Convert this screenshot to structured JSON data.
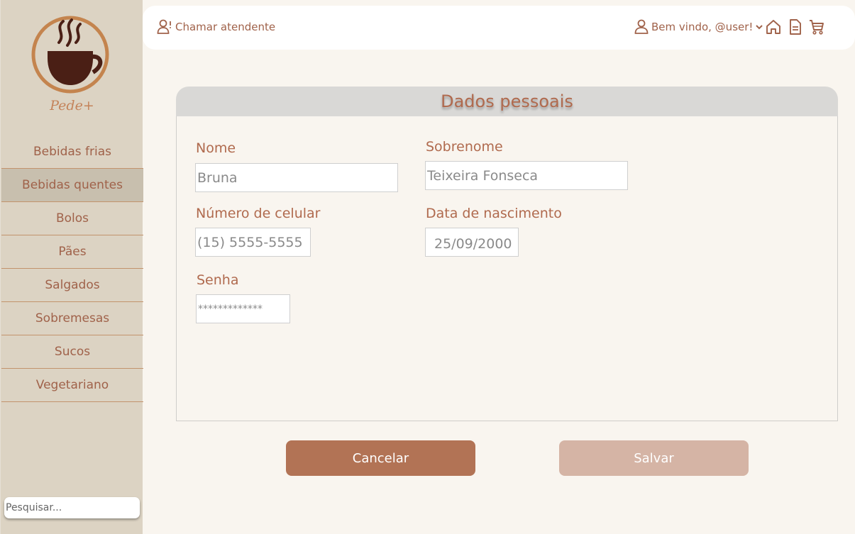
{
  "brand": {
    "name": "Pede+"
  },
  "sidebar": {
    "items": [
      {
        "label": "Bebidas frias"
      },
      {
        "label": "Bebidas quentes"
      },
      {
        "label": "Bolos"
      },
      {
        "label": "Pães"
      },
      {
        "label": "Salgados"
      },
      {
        "label": "Sobremesas"
      },
      {
        "label": "Sucos"
      },
      {
        "label": "Vegetariano"
      }
    ],
    "active_item": "Bebidas quentes",
    "search_placeholder": "Pesquisar..."
  },
  "topbar": {
    "call_label": "Chamar atendente",
    "welcome_label": "Bem vindo, @user!",
    "icons": [
      "call-attendant-icon",
      "user-icon",
      "chevron-down-icon",
      "home-icon",
      "document-icon",
      "cart-icon"
    ]
  },
  "form": {
    "title": "Dados pessoais",
    "fields": {
      "nome": {
        "label": "Nome",
        "value": "Bruna"
      },
      "sobrenome": {
        "label": "Sobrenome",
        "value": "Teixeira Fonseca"
      },
      "celular": {
        "label": "Número de  celular",
        "value": "(15) 5555-5555"
      },
      "nascimento": {
        "label": "Data de nascimento",
        "value": "25/09/2000"
      },
      "senha": {
        "label": "Senha",
        "value": "*************"
      }
    }
  },
  "actions": {
    "cancel_label": "Cancelar",
    "save_label": "Salvar"
  },
  "colors": {
    "accent": "#b06a4e",
    "sidebar_bg": "#dcd3c3",
    "page_bg": "#f9f5ef",
    "cancel_button": "#b27355",
    "save_button": "#d5b4a5"
  }
}
